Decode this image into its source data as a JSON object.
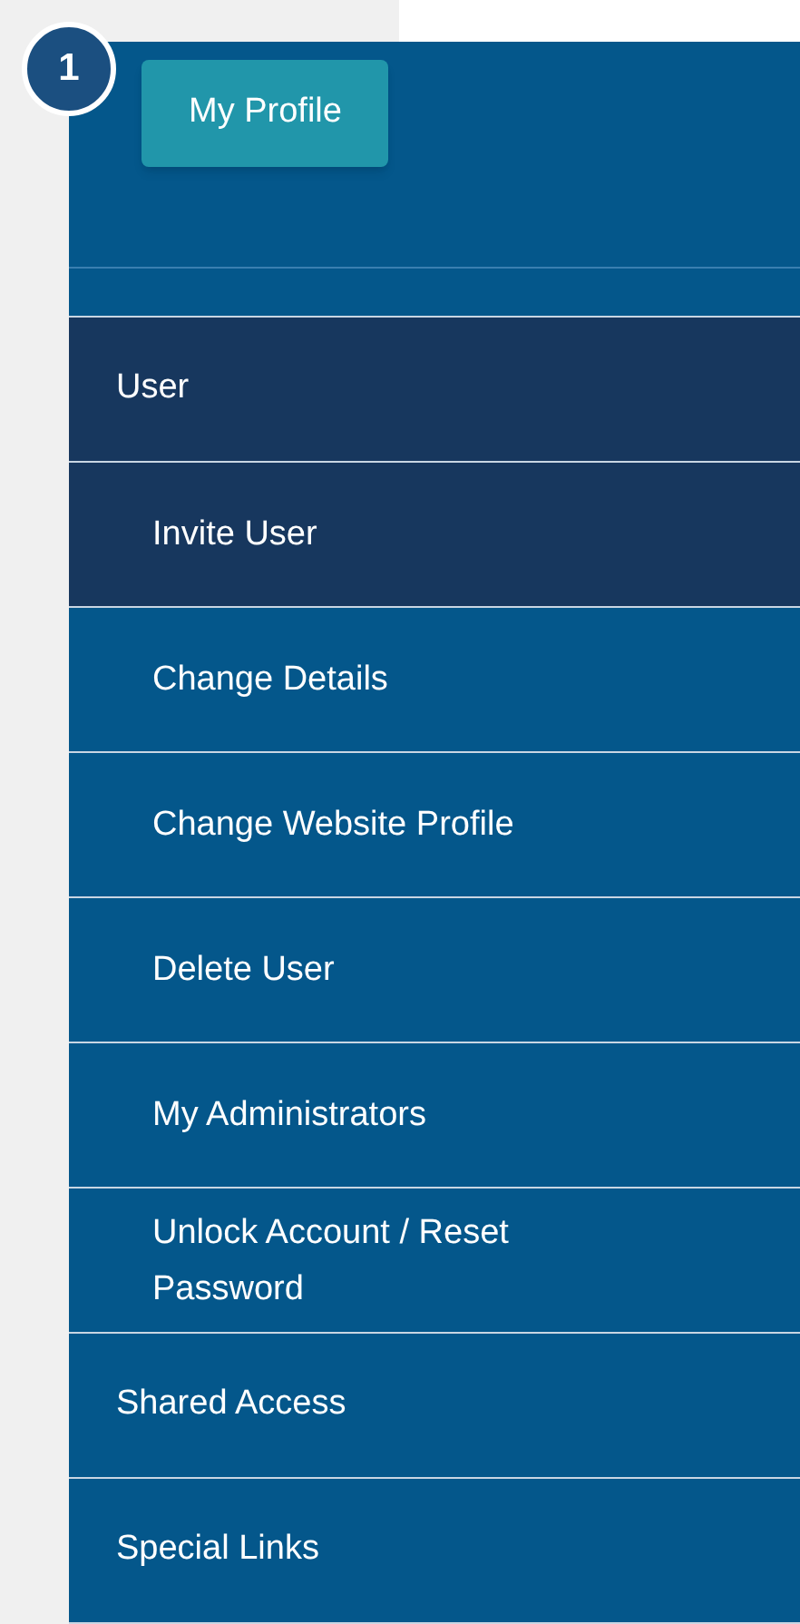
{
  "badge": "1",
  "profile_button": "My Profile",
  "menu": [
    {
      "label": "User",
      "expanded": true,
      "children": [
        {
          "label": "Invite User",
          "selected": true
        },
        {
          "label": "Change Details",
          "selected": false
        },
        {
          "label": "Change Website Profile",
          "selected": false
        },
        {
          "label": "Delete User",
          "selected": false
        },
        {
          "label": "My Administrators",
          "selected": false
        },
        {
          "label": "Unlock Account / Reset Password",
          "selected": false
        }
      ]
    },
    {
      "label": "Shared Access",
      "expanded": false
    },
    {
      "label": "Special Links",
      "expanded": false
    }
  ]
}
